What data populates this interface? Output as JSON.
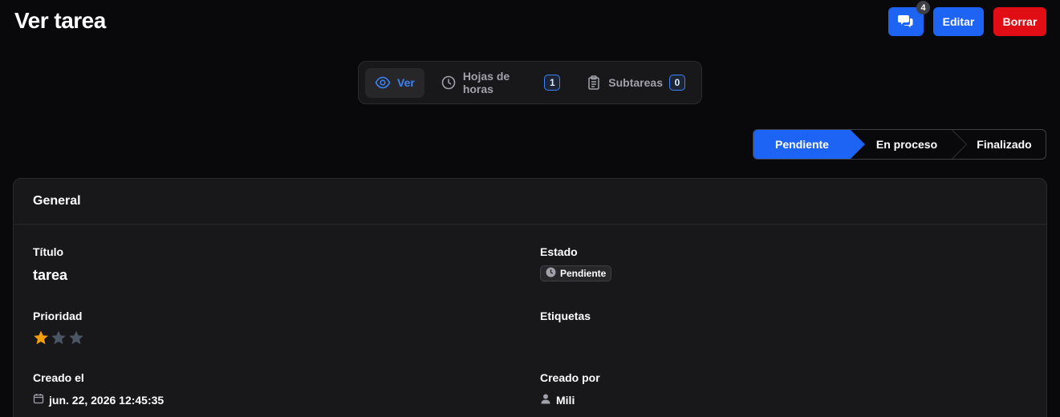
{
  "page": {
    "title": "Ver tarea"
  },
  "header_actions": {
    "comments_count": "4",
    "edit_label": "Editar",
    "delete_label": "Borrar"
  },
  "tabs": [
    {
      "label": "Ver",
      "icon": "eye-icon",
      "active": true
    },
    {
      "label": "Hojas de horas",
      "icon": "clock-icon",
      "count": "1"
    },
    {
      "label": "Subtareas",
      "icon": "clipboard-icon",
      "count": "0"
    }
  ],
  "status_steps": [
    "Pendiente",
    "En proceso",
    "Finalizado"
  ],
  "card": {
    "title": "General",
    "fields": {
      "title_label": "Título",
      "title_value": "tarea",
      "status_label": "Estado",
      "status_value": "Pendiente",
      "priority_label": "Prioridad",
      "priority_value": 1,
      "priority_max": 3,
      "tags_label": "Etiquetas",
      "created_at_label": "Creado el",
      "created_at_value": "jun. 22, 2026 12:45:35",
      "created_by_label": "Creado por",
      "created_by_value": "Mili"
    }
  },
  "colors": {
    "accent": "#1d64f5",
    "danger": "#e10d14",
    "star_active": "#f59e0b",
    "star_inactive": "#4b5563"
  }
}
